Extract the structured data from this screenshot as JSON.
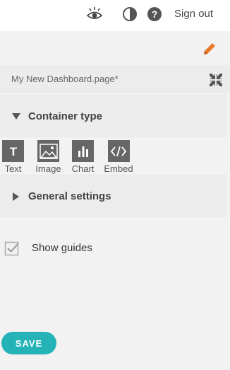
{
  "header": {
    "icons": [
      "eye-icon",
      "contrast-icon",
      "help-icon"
    ],
    "sign_out_label": "Sign out"
  },
  "page": {
    "title": "My New Dashboard.page*"
  },
  "sections": {
    "container_type": {
      "label": "Container type",
      "expanded": true,
      "items": [
        {
          "label": "Text",
          "icon": "text-icon"
        },
        {
          "label": "Image",
          "icon": "image-icon"
        },
        {
          "label": "Chart",
          "icon": "chart-icon"
        },
        {
          "label": "Embed",
          "icon": "embed-icon"
        }
      ]
    },
    "general_settings": {
      "label": "General settings",
      "expanded": false
    }
  },
  "options": {
    "show_guides_label": "Show guides",
    "show_guides_checked": true
  },
  "footer": {
    "save_label": "SAVE"
  },
  "colors": {
    "accent": "#25b3b7",
    "edit": "#e8792a",
    "tile": "#666666"
  }
}
